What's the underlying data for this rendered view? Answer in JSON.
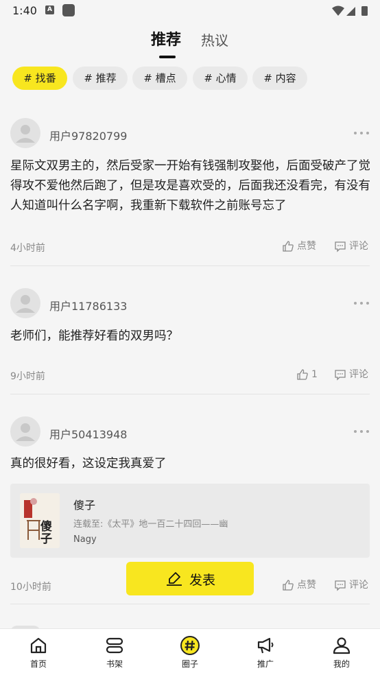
{
  "status_bar": {
    "time": "1:40"
  },
  "top_tabs": {
    "recommend": "推荐",
    "hot": "热议"
  },
  "chips": [
    "# 找番",
    "# 推荐",
    "# 槽点",
    "# 心情",
    "# 内容"
  ],
  "posts": [
    {
      "user": "用户97820799",
      "text": "星际文双男主的，然后受家一开始有钱强制攻娶他，后面受破产了觉得攻不爱他然后跑了，但是攻是喜欢受的，后面我还没看完，有没有人知道叫什么名字啊，我重新下载软件之前账号忘了",
      "time": "4小时前",
      "like": "点赞",
      "comment": "评论"
    },
    {
      "user": "用户11786133",
      "text": "老师们，能推荐好看的双男吗？",
      "time": "9小时前",
      "like": "1",
      "comment": "评论"
    },
    {
      "user": "用户50413948",
      "text": "真的很好看，这设定我真爱了",
      "time": "10小时前",
      "like": "点赞",
      "comment": "评论",
      "book": {
        "title": "傻子",
        "progress": "连载至:《太平》地一百二十四回——幽",
        "author": "Nagy",
        "cover_text": "傻子"
      }
    }
  ],
  "publish_button": "发表",
  "bottom_nav": [
    "首页",
    "书架",
    "圈子",
    "推广",
    "我的"
  ],
  "colors": {
    "accent": "#f8e61f",
    "background": "#f5f5f5"
  }
}
